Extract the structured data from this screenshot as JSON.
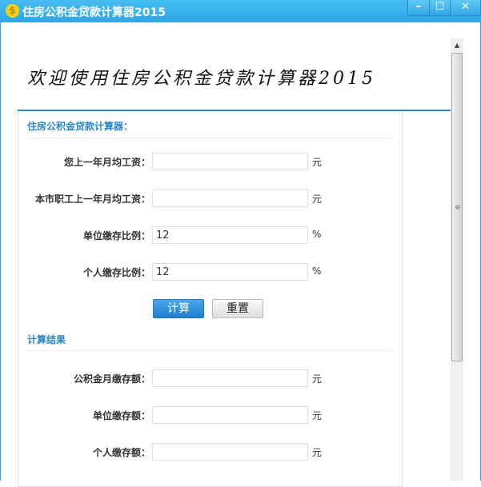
{
  "window": {
    "title": "住房公积金贷款计算器2015",
    "icon": "$",
    "minimize": "–",
    "maximize": "☐",
    "close": "✕"
  },
  "hero": "欢迎使用住房公积金贷款计算器2015",
  "calculator": {
    "heading": "住房公积金贷款计算器：",
    "fields": [
      {
        "label": "您上一年月均工资：",
        "value": "",
        "unit": "元"
      },
      {
        "label": "本市职工上一年月均工资：",
        "value": "",
        "unit": "元"
      },
      {
        "label": "单位缴存比例：",
        "value": "12",
        "unit": "%"
      },
      {
        "label": "个人缴存比例：",
        "value": "12",
        "unit": "%"
      }
    ],
    "calculate_label": "计算",
    "reset_label": "重置"
  },
  "results": {
    "heading": "计算结果",
    "fields": [
      {
        "label": "公积金月缴存额：",
        "value": "",
        "unit": "元"
      },
      {
        "label": "单位缴存额：",
        "value": "",
        "unit": "元"
      },
      {
        "label": "个人缴存额：",
        "value": "",
        "unit": "元"
      }
    ]
  }
}
